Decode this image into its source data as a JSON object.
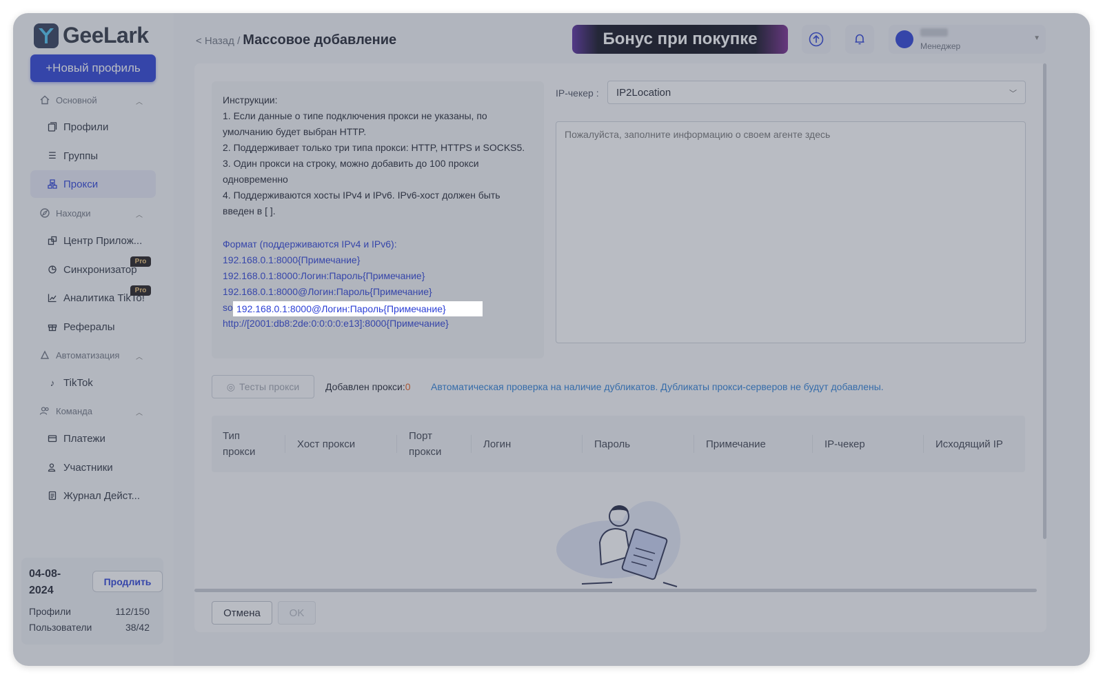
{
  "brand": {
    "name": "GeeLark"
  },
  "sidebar": {
    "new_profile": "+Новый профиль",
    "sections": [
      {
        "label": "Основной",
        "items": [
          "Профили",
          "Группы",
          "Прокси"
        ]
      },
      {
        "label": "Находки",
        "items": [
          "Центр Прилож...",
          "Синхронизатор",
          "Аналитика TikTo!",
          "Рефералы"
        ]
      },
      {
        "label": "Автоматизация",
        "items": [
          "TikTok"
        ]
      },
      {
        "label": "Команда",
        "items": [
          "Платежи",
          "Участники",
          "Журнал Дейст..."
        ]
      }
    ],
    "active_item": "Прокси",
    "pro_badge": "Pro",
    "plan": {
      "date": "04-08-2024",
      "renew": "Продлить",
      "profiles_label": "Профили",
      "profiles_value": "112/150",
      "users_label": "Пользователи",
      "users_value": "38/42"
    }
  },
  "header": {
    "back": "< Назад /",
    "title": "Массовое добавление",
    "bonus": "Бонус при покупке",
    "user_role": "Менеджер"
  },
  "instructions": {
    "heading": "Инструкции:",
    "lines": [
      "1. Если данные о типе подключения прокси не указаны, по умолчанию будет выбран HTTP.",
      "2. Поддерживает только три типа прокси: HTTP, HTTPS и SOCKS5.",
      "3. Один прокси на строку, можно добавить до 100 прокси одновременно",
      "4. Поддерживаются хосты IPv4 и IPv6. IPv6-хост должен быть введен в [ ]."
    ],
    "format_heading": "Формат (поддерживаются IPv4 и IPv6):",
    "formats": [
      "192.168.0.1:8000{Примечание}",
      "192.168.0.1:8000:Логин:Пароль{Примечание}",
      "192.168.0.1:8000@Логин:Пароль{Примечание}",
      "socks5://192.168.0.1:8000{Примечание}",
      "http://[2001:db8:2de:0:0:0:0:e13]:8000{Примечание}"
    ],
    "highlighted_index": 2
  },
  "checker": {
    "label": "IP-чекер :",
    "value": "IP2Location"
  },
  "textarea": {
    "placeholder": "Пожалуйста, заполните информацию о своем агенте здесь"
  },
  "toolbar": {
    "test": "Тесты прокси",
    "added_label": "Добавлен прокси:",
    "added_count": "0",
    "note": "Автоматическая проверка на наличие дубликатов. Дубликаты прокси-серверов не будут добавлены."
  },
  "table": {
    "columns": [
      "Тип прокси",
      "Хост прокси",
      "Порт прокси",
      "Логин",
      "Пароль",
      "Примечание",
      "IP-чекер",
      "Исходящий IP"
    ]
  },
  "footer": {
    "cancel": "Отмена",
    "ok": "OK"
  }
}
